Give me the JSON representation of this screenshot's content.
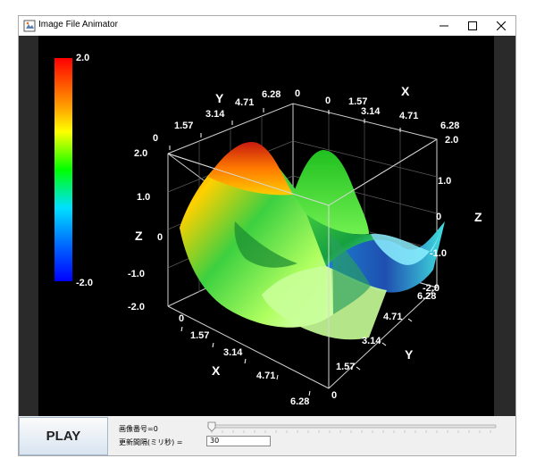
{
  "window": {
    "title": "Image File Animator"
  },
  "colorbar": {
    "max_label": "2.0",
    "min_label": "-2.0"
  },
  "plot": {
    "y_axis_title": "Y",
    "x_axis_title": "X",
    "z_axis_title": "Z",
    "top_y_ticks": [
      "1.57",
      "3.14",
      "4.71",
      "6.28"
    ],
    "top_y_zero": "0",
    "top_x_zero": "0",
    "top_x_ticks": [
      "1.57",
      "3.14",
      "4.71",
      "6.28"
    ],
    "left_z_ticks": [
      "2.0",
      "1.0",
      "0",
      "-1.0",
      "-2.0"
    ],
    "left_top_zero": "0",
    "right_z_ticks": [
      "2.0",
      "1.0",
      "0",
      "-1.0",
      "-2.0"
    ],
    "bottom_x_ticks": [
      "0",
      "1.57",
      "3.14",
      "4.71",
      "6.28"
    ],
    "bottom_x_end_zero": "0",
    "bottom_y_ticks": [
      "1.57",
      "3.14",
      "4.71",
      "6.28"
    ]
  },
  "controls": {
    "play_label": "PLAY",
    "image_number_label": "画像番号=0",
    "interval_label": "更新間隔(ミリ秒) =",
    "interval_value": "30",
    "slider_value": 0
  }
}
